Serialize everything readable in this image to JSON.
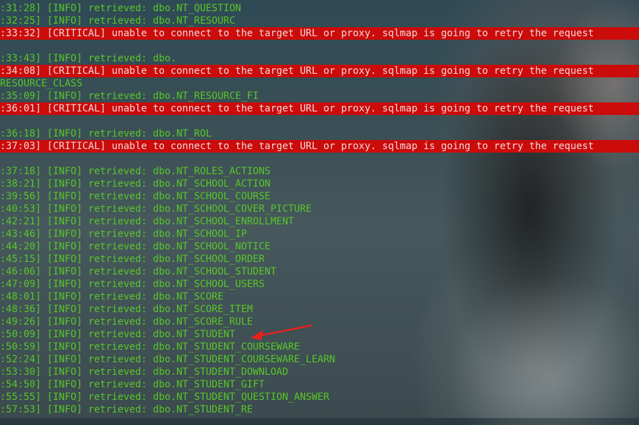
{
  "terminal": {
    "lines": [
      {
        "type": "info",
        "text": ":31:28] [INFO] retrieved: dbo.NT_QUESTION"
      },
      {
        "type": "info",
        "text": ":32:25] [INFO] retrieved: dbo.NT_RESOURC"
      },
      {
        "type": "critical",
        "text": ":33:32] [CRITICAL] unable to connect to the target URL or proxy. sqlmap is going to retry the request"
      },
      {
        "type": "blank",
        "text": ""
      },
      {
        "type": "info",
        "text": ":33:43] [INFO] retrieved: dbo."
      },
      {
        "type": "critical",
        "text": ":34:08] [CRITICAL] unable to connect to the target URL or proxy. sqlmap is going to retry the request"
      },
      {
        "type": "info",
        "text": "RESOURCE_CLASS"
      },
      {
        "type": "info",
        "text": ":35:09] [INFO] retrieved: dbo.NT_RESOURCE_FI"
      },
      {
        "type": "critical",
        "text": ":36:01] [CRITICAL] unable to connect to the target URL or proxy. sqlmap is going to retry the request"
      },
      {
        "type": "blank",
        "text": ""
      },
      {
        "type": "info",
        "text": ":36:18] [INFO] retrieved: dbo.NT_ROL"
      },
      {
        "type": "critical",
        "text": ":37:03] [CRITICAL] unable to connect to the target URL or proxy. sqlmap is going to retry the request"
      },
      {
        "type": "blank",
        "text": ""
      },
      {
        "type": "info",
        "text": ":37:18] [INFO] retrieved: dbo.NT_ROLES_ACTIONS"
      },
      {
        "type": "info",
        "text": ":38:21] [INFO] retrieved: dbo.NT_SCHOOL_ACTION"
      },
      {
        "type": "info",
        "text": ":39:56] [INFO] retrieved: dbo.NT_SCHOOL_COURSE"
      },
      {
        "type": "info",
        "text": ":40:53] [INFO] retrieved: dbo.NT_SCHOOL_COVER_PICTURE"
      },
      {
        "type": "info",
        "text": ":42:21] [INFO] retrieved: dbo.NT_SCHOOL_ENROLLMENT"
      },
      {
        "type": "info",
        "text": ":43:46] [INFO] retrieved: dbo.NT_SCHOOL_IP"
      },
      {
        "type": "info",
        "text": ":44:20] [INFO] retrieved: dbo.NT_SCHOOL_NOTICE"
      },
      {
        "type": "info",
        "text": ":45:15] [INFO] retrieved: dbo.NT_SCHOOL_ORDER"
      },
      {
        "type": "info",
        "text": ":46:06] [INFO] retrieved: dbo.NT_SCHOOL_STUDENT"
      },
      {
        "type": "info",
        "text": ":47:09] [INFO] retrieved: dbo.NT_SCHOOL_USERS"
      },
      {
        "type": "info",
        "text": ":48:01] [INFO] retrieved: dbo.NT_SCORE"
      },
      {
        "type": "info",
        "text": ":48:36] [INFO] retrieved: dbo.NT_SCORE_ITEM"
      },
      {
        "type": "info",
        "text": ":49:26] [INFO] retrieved: dbo.NT_SCORE_RULE"
      },
      {
        "type": "info",
        "text": ":50:09] [INFO] retrieved: dbo.NT_STUDENT"
      },
      {
        "type": "info",
        "text": ":50:59] [INFO] retrieved: dbo.NT_STUDENT_COURSEWARE"
      },
      {
        "type": "info",
        "text": ":52:24] [INFO] retrieved: dbo.NT_STUDENT_COURSEWARE_LEARN"
      },
      {
        "type": "info",
        "text": ":53:30] [INFO] retrieved: dbo.NT_STUDENT_DOWNLOAD"
      },
      {
        "type": "info",
        "text": ":54:50] [INFO] retrieved: dbo.NT_STUDENT_GIFT"
      },
      {
        "type": "info",
        "text": ":55:55] [INFO] retrieved: dbo.NT_STUDENT_QUESTION_ANSWER"
      },
      {
        "type": "info",
        "text": ":57:53] [INFO] retrieved: dbo.NT_STUDENT_RE"
      }
    ]
  },
  "colors": {
    "info_text": "#58c629",
    "critical_bg": "#cc0b0b",
    "critical_text": "#f2d8d8",
    "arrow": "#e8211d"
  },
  "annotation": {
    "icon": "red-arrow-icon"
  }
}
